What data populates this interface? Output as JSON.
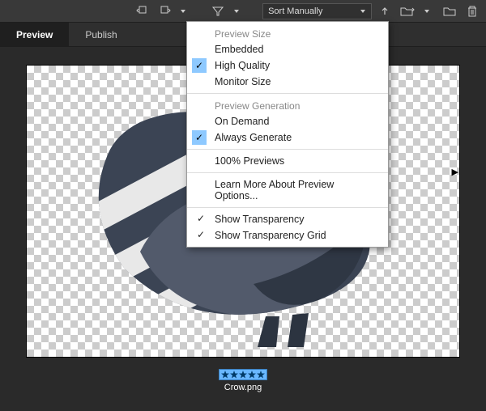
{
  "toolbar": {
    "sort_label": "Sort Manually"
  },
  "tabs": {
    "preview": "Preview",
    "publish": "Publish"
  },
  "menu": {
    "header_size": "Preview Size",
    "embedded": "Embedded",
    "high_quality": "High Quality",
    "monitor_size": "Monitor Size",
    "header_gen": "Preview Generation",
    "on_demand": "On Demand",
    "always_generate": "Always Generate",
    "hundred_previews": "100% Previews",
    "learn_more": "Learn More About Preview Options...",
    "show_transparency": "Show Transparency",
    "show_transparency_grid": "Show Transparency Grid"
  },
  "file": {
    "name": "Crow.png",
    "rating": 5
  }
}
